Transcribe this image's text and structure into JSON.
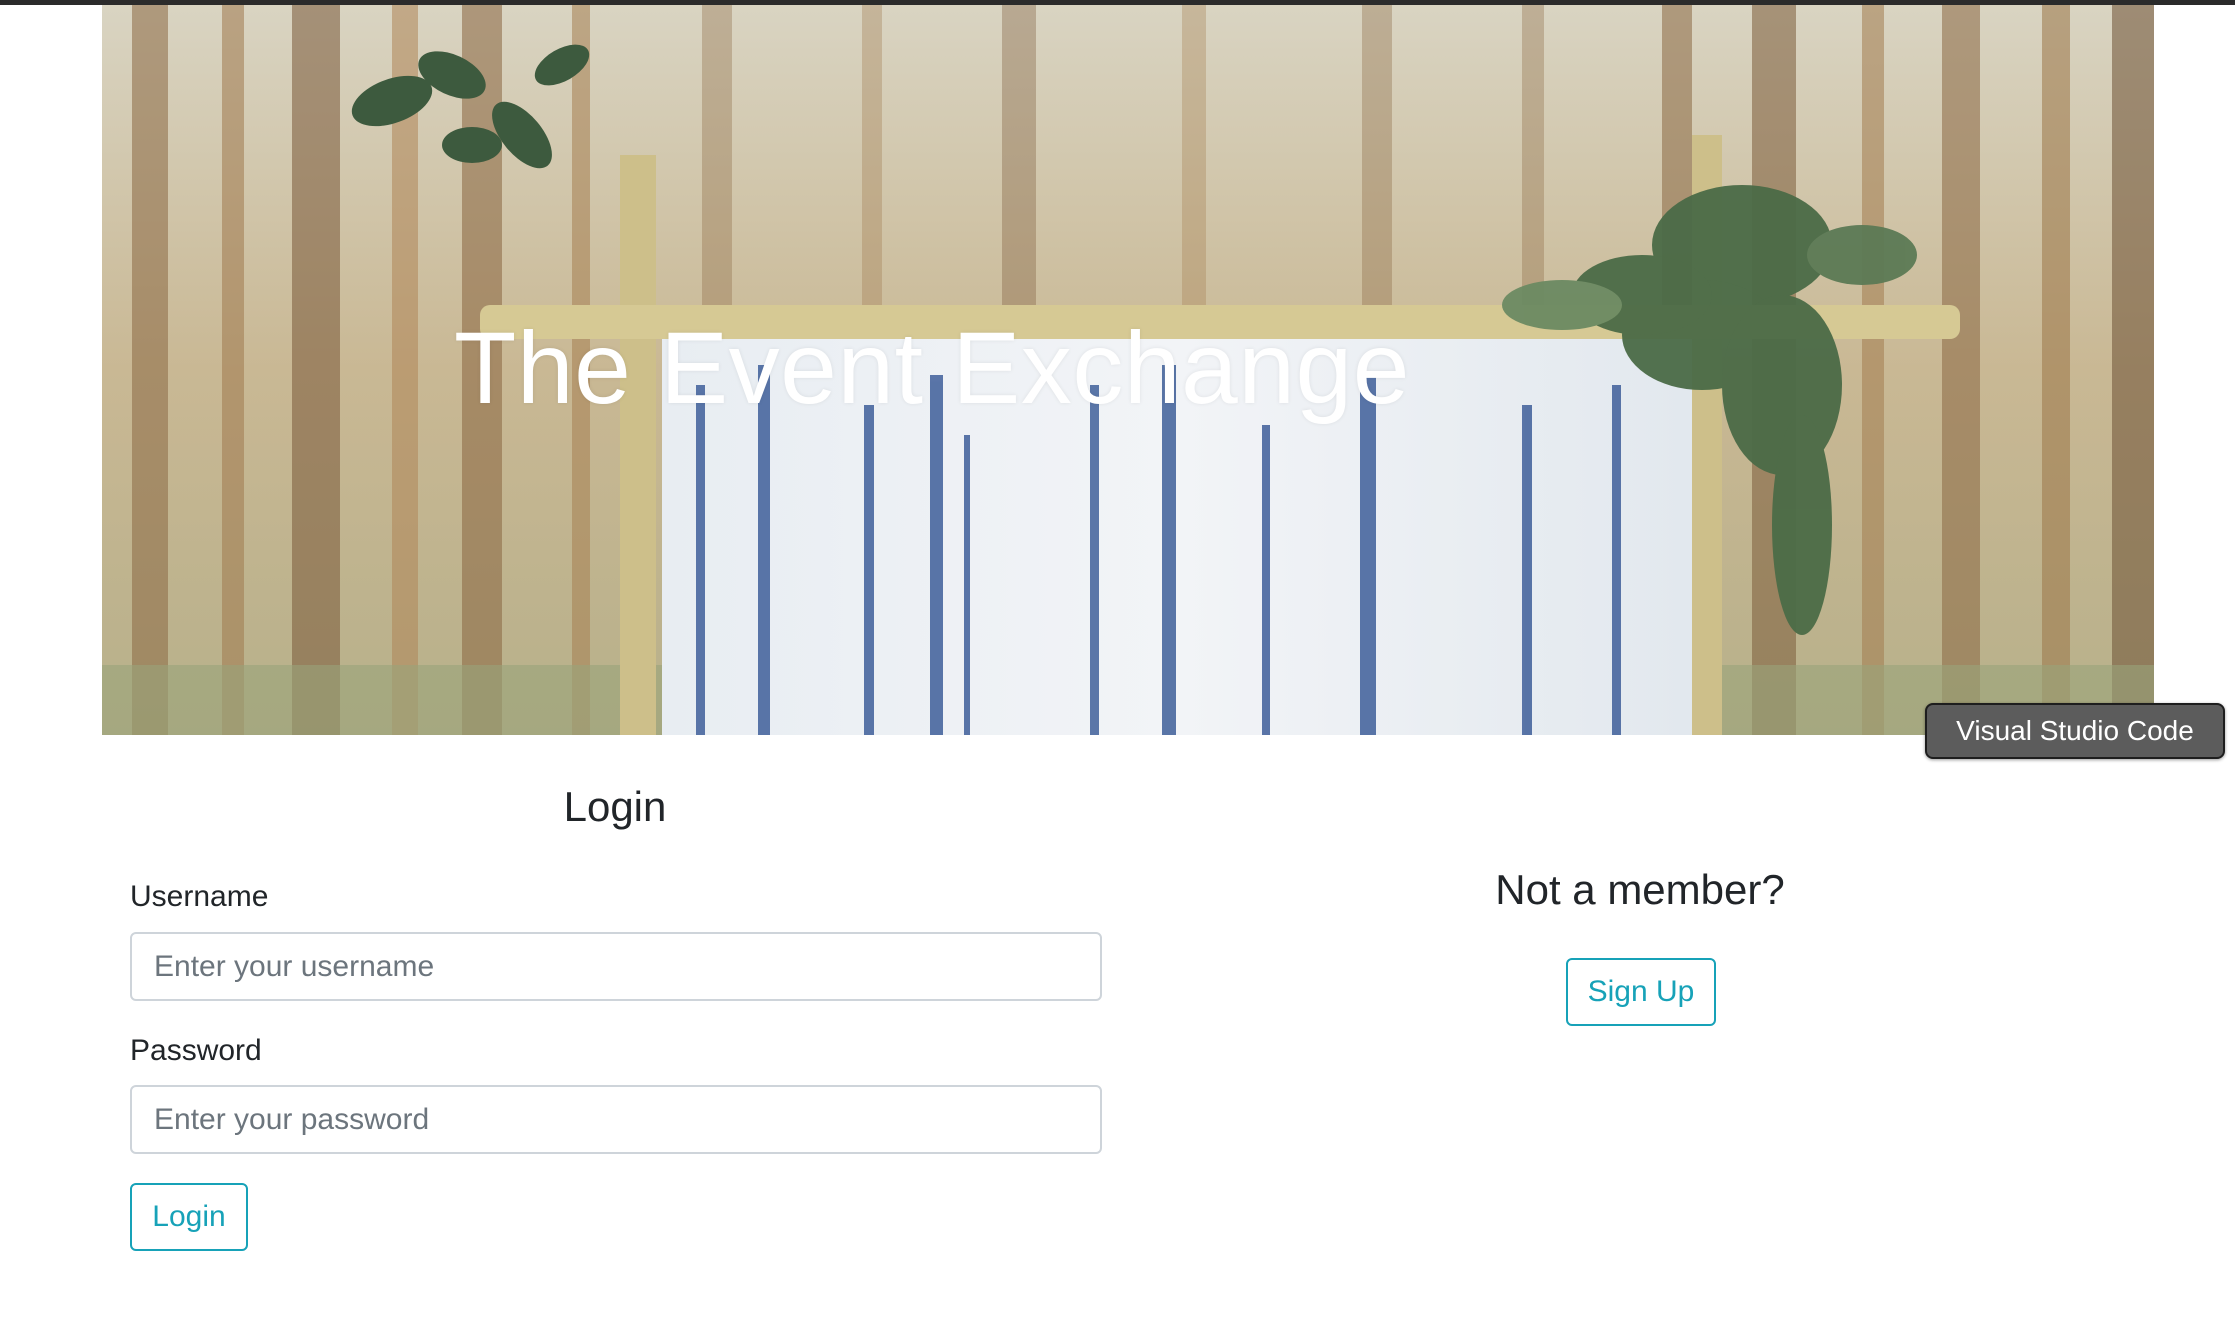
{
  "hero": {
    "title": "The Event Exchange"
  },
  "tooltip": {
    "text": "Visual Studio Code"
  },
  "login": {
    "heading": "Login",
    "username_label": "Username",
    "username_placeholder": "Enter your username",
    "username_value": "",
    "password_label": "Password",
    "password_placeholder": "Enter your password",
    "password_value": "",
    "submit_label": "Login"
  },
  "signup": {
    "heading": "Not a member?",
    "button_label": "Sign Up"
  },
  "colors": {
    "accent": "#17a2b8",
    "text": "#212529",
    "input_border": "#ced4da",
    "tooltip_bg": "#5c5c5c"
  }
}
